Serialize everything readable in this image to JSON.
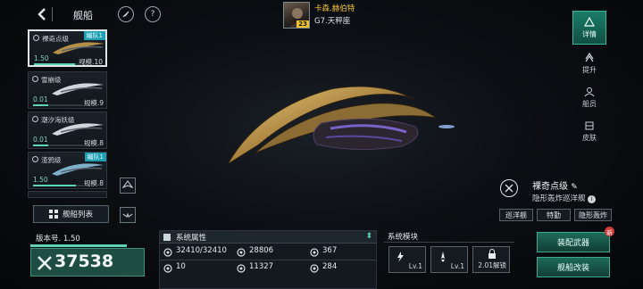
{
  "header": {
    "title": "舰船",
    "back_icon": "chevron-left-icon",
    "feather_icon": "feather-icon",
    "help_label": "?"
  },
  "player": {
    "name": "卡森.赫伯特",
    "zone": "G7.天秤座",
    "level": "23"
  },
  "ship_list": [
    {
      "name": "裸奇点级",
      "version": "1.50",
      "scale": "规模.10",
      "badge": "编队1",
      "selected": true,
      "progress": 0.85
    },
    {
      "name": "雪崩级",
      "version": "0.01",
      "scale": "规模.9",
      "badge": "",
      "selected": false,
      "progress": 0.3
    },
    {
      "name": "潮汐海妖级",
      "version": "0.01",
      "scale": "规模.8",
      "badge": "",
      "selected": false,
      "progress": 0.3
    },
    {
      "name": "渣鸦级",
      "version": "1.50",
      "scale": "规模.8",
      "badge": "编队1",
      "selected": false,
      "progress": 0.85
    }
  ],
  "ship_list_button": "舰船列表",
  "version_label": "版本号. 1.50",
  "power": "37538",
  "ship_info": {
    "name": "裸奇点级",
    "class": "隐形轰炸巡洋舰",
    "tags": [
      "巡洋舰",
      "特勤",
      "隐形轰炸"
    ]
  },
  "system_attributes": {
    "title": "系统属性",
    "stats": [
      {
        "icon": "hull-icon",
        "value": "32410/32410"
      },
      {
        "icon": "armor-icon",
        "value": "28806"
      },
      {
        "icon": "speed-icon",
        "value": "367"
      },
      {
        "icon": "dps-icon",
        "value": "10"
      },
      {
        "icon": "shield-icon",
        "value": "11327"
      },
      {
        "icon": "firepower-icon",
        "value": "284"
      }
    ]
  },
  "system_modules": {
    "title": "系统模块",
    "modules": [
      {
        "icon": "lightning-icon",
        "label": "Lv.1"
      },
      {
        "icon": "missile-icon",
        "label": "Lv.1"
      },
      {
        "icon": "lock-icon",
        "label": "2.01解锁"
      }
    ]
  },
  "right_nav": [
    "详情",
    "提升",
    "船员",
    "皮肤"
  ],
  "actions": {
    "equip": "装配武器",
    "refit": "舰船改装",
    "new_badge": "新"
  },
  "colors": {
    "accent_teal": "#1d6a59",
    "gold": "#f2c63a",
    "power_box": "#1e4d44"
  }
}
